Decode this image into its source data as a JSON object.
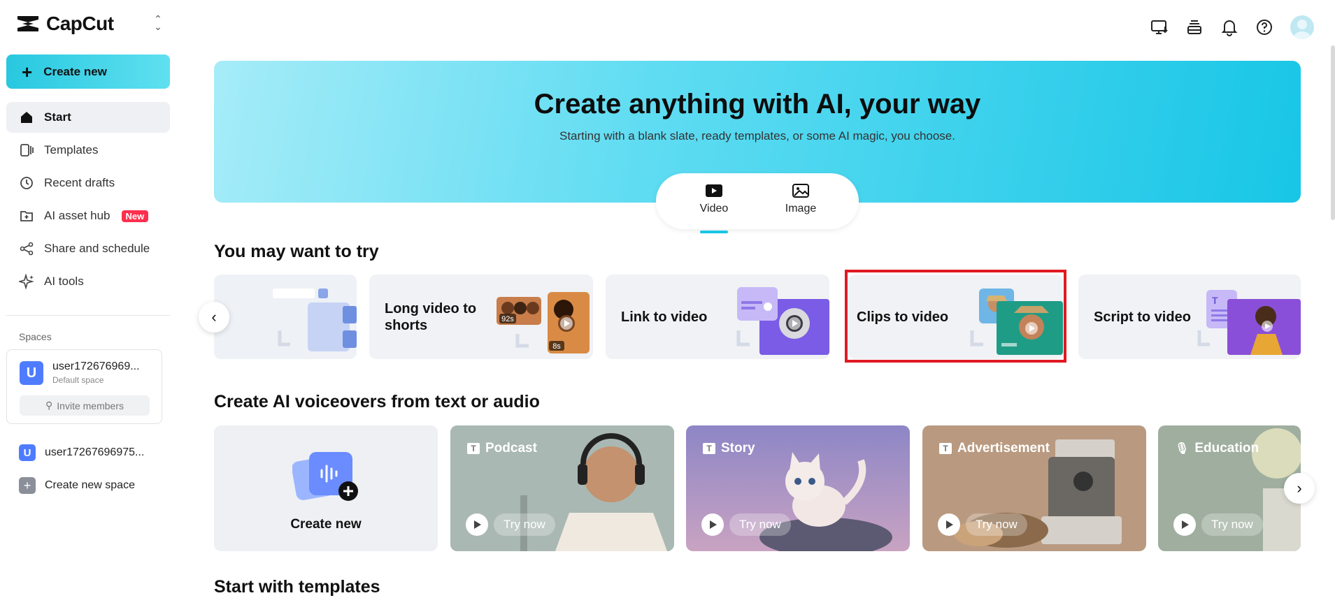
{
  "app": {
    "name": "CapCut"
  },
  "sidebar": {
    "create_label": "Create new",
    "items": [
      {
        "label": "Start",
        "icon": "home-icon",
        "active": true
      },
      {
        "label": "Templates",
        "icon": "templates-icon"
      },
      {
        "label": "Recent drafts",
        "icon": "clock-icon"
      },
      {
        "label": "AI asset hub",
        "icon": "asset-hub-icon",
        "badge": "New"
      },
      {
        "label": "Share and schedule",
        "icon": "share-icon"
      },
      {
        "label": "AI tools",
        "icon": "sparkle-icon"
      }
    ],
    "spaces_title": "Spaces",
    "space_card": {
      "avatar": "U",
      "name": "user172676969...",
      "sub": "Default space",
      "invite_label": "Invite members"
    },
    "other_space": {
      "avatar": "U",
      "name": "user17267696975..."
    },
    "create_space_label": "Create new space"
  },
  "topbar": {
    "icons": [
      "desktop-download-icon",
      "layers-icon",
      "bell-icon",
      "help-icon",
      "user-avatar"
    ]
  },
  "hero": {
    "title": "Create anything with AI, your way",
    "subtitle": "Starting with a blank slate, ready templates, or some AI magic, you choose.",
    "modes": [
      {
        "label": "Video",
        "active": true
      },
      {
        "label": "Image"
      }
    ]
  },
  "try_section": {
    "title": "You may want to try",
    "cards": [
      {
        "label": ""
      },
      {
        "label": "Long video to shorts",
        "tags": [
          "92s",
          "8s"
        ]
      },
      {
        "label": "Link to video"
      },
      {
        "label": "Clips to video"
      },
      {
        "label": "Script to video"
      }
    ]
  },
  "voiceover_section": {
    "title": "Create AI voiceovers from text or audio",
    "create_label": "Create new",
    "cards": [
      {
        "title": "Podcast",
        "try": "Try now",
        "bg": "#a9b8b4"
      },
      {
        "title": "Story",
        "try": "Try now",
        "bg": "#9b97c8"
      },
      {
        "title": "Advertisement",
        "try": "Try now",
        "bg": "#b8957a"
      },
      {
        "title": "Education",
        "try": "Try now",
        "bg": "#9fae9f"
      }
    ]
  },
  "templates_section": {
    "title": "Start with templates"
  },
  "colors": {
    "accent": "#19c7e6",
    "new_badge": "#ff2f4e",
    "highlight": "#e01a22"
  }
}
